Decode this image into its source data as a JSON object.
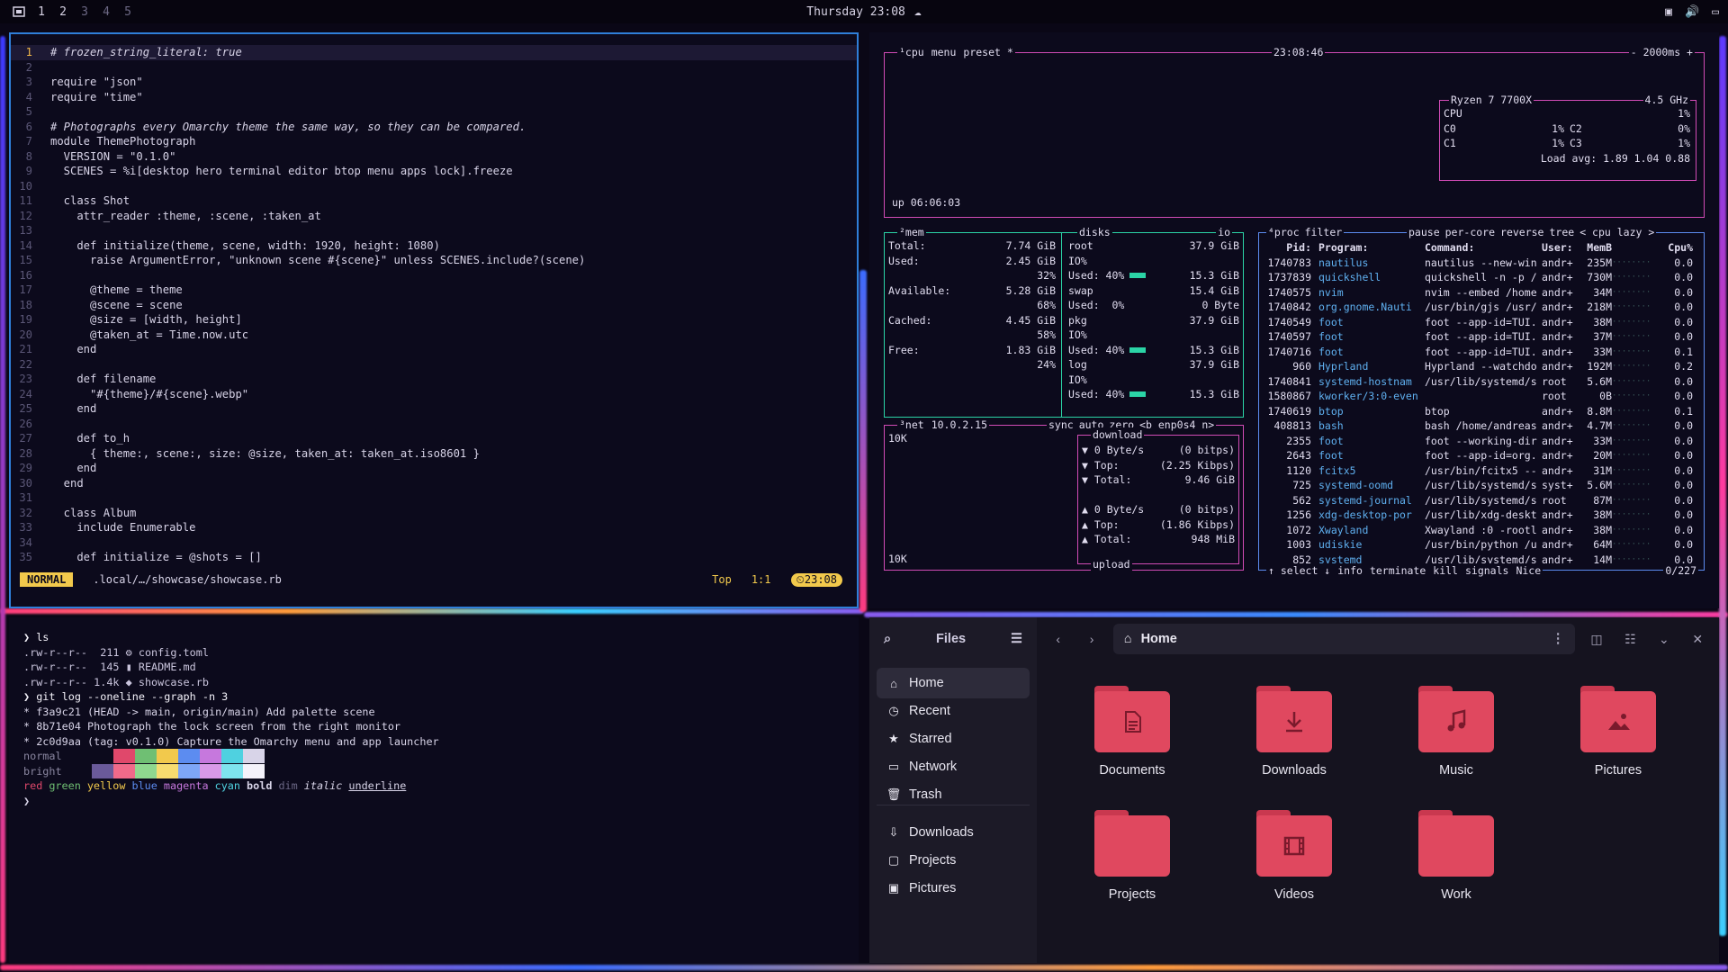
{
  "topbar": {
    "workspaces": [
      "1",
      "2",
      "3",
      "4",
      "5"
    ],
    "clock": "Thursday 23:08"
  },
  "editor": {
    "lines": [
      {
        "n": "1",
        "t": "# frozen_string_literal: true"
      },
      {
        "n": "2",
        "t": ""
      },
      {
        "n": "3",
        "t": "require \"json\""
      },
      {
        "n": "4",
        "t": "require \"time\""
      },
      {
        "n": "5",
        "t": ""
      },
      {
        "n": "6",
        "t": "# Photographs every Omarchy theme the same way, so they can be compared."
      },
      {
        "n": "7",
        "t": "module ThemePhotograph"
      },
      {
        "n": "8",
        "t": "  VERSION = \"0.1.0\""
      },
      {
        "n": "9",
        "t": "  SCENES = %i[desktop hero terminal editor btop menu apps lock].freeze"
      },
      {
        "n": "10",
        "t": ""
      },
      {
        "n": "11",
        "t": "  class Shot"
      },
      {
        "n": "12",
        "t": "    attr_reader :theme, :scene, :taken_at"
      },
      {
        "n": "13",
        "t": ""
      },
      {
        "n": "14",
        "t": "    def initialize(theme, scene, width: 1920, height: 1080)"
      },
      {
        "n": "15",
        "t": "      raise ArgumentError, \"unknown scene #{scene}\" unless SCENES.include?(scene)"
      },
      {
        "n": "16",
        "t": ""
      },
      {
        "n": "17",
        "t": "      @theme = theme"
      },
      {
        "n": "18",
        "t": "      @scene = scene"
      },
      {
        "n": "19",
        "t": "      @size = [width, height]"
      },
      {
        "n": "20",
        "t": "      @taken_at = Time.now.utc"
      },
      {
        "n": "21",
        "t": "    end"
      },
      {
        "n": "22",
        "t": ""
      },
      {
        "n": "23",
        "t": "    def filename"
      },
      {
        "n": "24",
        "t": "      \"#{theme}/#{scene}.webp\""
      },
      {
        "n": "25",
        "t": "    end"
      },
      {
        "n": "26",
        "t": ""
      },
      {
        "n": "27",
        "t": "    def to_h"
      },
      {
        "n": "28",
        "t": "      { theme:, scene:, size: @size, taken_at: taken_at.iso8601 }"
      },
      {
        "n": "29",
        "t": "    end"
      },
      {
        "n": "30",
        "t": "  end"
      },
      {
        "n": "31",
        "t": ""
      },
      {
        "n": "32",
        "t": "  class Album"
      },
      {
        "n": "33",
        "t": "    include Enumerable"
      },
      {
        "n": "34",
        "t": ""
      },
      {
        "n": "35",
        "t": "    def initialize = @shots = []"
      }
    ],
    "mode": "NORMAL",
    "file": ".local/…/showcase/showcase.rb",
    "position_word": "Top",
    "cursor": "1:1",
    "time": "23:08"
  },
  "btop": {
    "cpu_header": [
      "¹cpu",
      "menu",
      "preset *"
    ],
    "clock": "23:08:46",
    "interval": "- 2000ms +",
    "uptime": "up 06:06:03",
    "cpu_model": "Ryzen 7 7700X",
    "cpu_freq": "4.5 GHz",
    "cpu_rows": [
      {
        "l": "CPU",
        "v": "1%"
      },
      {
        "l": "C0",
        "v": "1%",
        "l2": "C2",
        "v2": "0%"
      },
      {
        "l": "C1",
        "v": "1%",
        "l2": "C3",
        "v2": "1%"
      }
    ],
    "load_avg": "Load avg: 1.89 1.04 0.88",
    "mem_header": "²mem",
    "disks_header": "disks",
    "io_label": "io",
    "mem_rows": [
      {
        "k": "Total:",
        "v": "7.74 GiB"
      },
      {
        "k": "Used:",
        "v": "2.45 GiB",
        "p": "32%"
      },
      {
        "k": "Available:",
        "v": "5.28 GiB",
        "p": "68%"
      },
      {
        "k": "Cached:",
        "v": "4.45 GiB",
        "p": "58%"
      },
      {
        "k": "Free:",
        "v": "1.83 GiB",
        "p": "24%"
      }
    ],
    "disk_rows": [
      {
        "k": "root",
        "v": "37.9 GiB"
      },
      {
        "k": "IO%",
        "v": ""
      },
      {
        "k": "Used: 40%",
        "v": "15.3 GiB",
        "fill": 0.4
      },
      {
        "k": "swap",
        "v": "15.4 GiB"
      },
      {
        "k": "Used:  0%",
        "v": "0 Byte"
      },
      {
        "k": "pkg",
        "v": "37.9 GiB"
      },
      {
        "k": "IO%",
        "v": ""
      },
      {
        "k": "Used: 40%",
        "v": "15.3 GiB",
        "fill": 0.4
      },
      {
        "k": "log",
        "v": "37.9 GiB"
      },
      {
        "k": "IO%",
        "v": ""
      },
      {
        "k": "Used: 40%",
        "v": "15.3 GiB",
        "fill": 0.4
      }
    ],
    "net_header": [
      "³net",
      "10.0.2.15",
      "sync",
      "auto",
      "zero",
      "<b enp0s4 n>"
    ],
    "net_scale_top": "10K",
    "net_scale_bottom": "10K",
    "download_label": "download",
    "upload_label": "upload",
    "down_rows": [
      {
        "k": "▼ 0 Byte/s",
        "v": "(0 bitps)"
      },
      {
        "k": "▼ Top:",
        "v": "(2.25 Kibps)"
      },
      {
        "k": "▼ Total:",
        "v": "9.46 GiB"
      }
    ],
    "up_rows": [
      {
        "k": "▲ 0 Byte/s",
        "v": "(0 bitps)"
      },
      {
        "k": "▲ Top:",
        "v": "(1.86 Kibps)"
      },
      {
        "k": "▲ Total:",
        "v": "948 MiB"
      }
    ],
    "proc_header": [
      "⁴proc",
      "filter",
      "pause",
      "per-core",
      "reverse",
      "tree",
      "< cpu lazy >"
    ],
    "proc_cols": [
      "Pid:",
      "Program:",
      "Command:",
      "User:",
      "MemB",
      "",
      "Cpu%"
    ],
    "procs": [
      [
        "1740783",
        "nautilus",
        "nautilus --new-win",
        "andr+",
        "235M",
        "0.0"
      ],
      [
        "1737839",
        "quickshell",
        "quickshell -n -p /",
        "andr+",
        "730M",
        "0.0"
      ],
      [
        "1740575",
        "nvim",
        "nvim --embed /home",
        "andr+",
        "34M",
        "0.0"
      ],
      [
        "1740842",
        "org.gnome.Nauti",
        "/usr/bin/gjs /usr/",
        "andr+",
        "218M",
        "0.0"
      ],
      [
        "1740549",
        "foot",
        "foot --app-id=TUI.",
        "andr+",
        "38M",
        "0.0"
      ],
      [
        "1740597",
        "foot",
        "foot --app-id=TUI.",
        "andr+",
        "37M",
        "0.0"
      ],
      [
        "1740716",
        "foot",
        "foot --app-id=TUI.",
        "andr+",
        "33M",
        "0.1"
      ],
      [
        "960",
        "Hyprland",
        "Hyprland --watchdo",
        "andr+",
        "192M",
        "0.2"
      ],
      [
        "1740841",
        "systemd-hostnam",
        "/usr/lib/systemd/s",
        "root",
        "5.6M",
        "0.0"
      ],
      [
        "1580867",
        "kworker/3:0-even",
        "",
        "root",
        "0B",
        "0.0"
      ],
      [
        "1740619",
        "btop",
        "btop",
        "andr+",
        "8.8M",
        "0.1"
      ],
      [
        "408813",
        "bash",
        "bash /home/andreas",
        "andr+",
        "4.7M",
        "0.0"
      ],
      [
        "2355",
        "foot",
        "foot --working-dir",
        "andr+",
        "33M",
        "0.0"
      ],
      [
        "2643",
        "foot",
        "foot --app-id=org.",
        "andr+",
        "20M",
        "0.0"
      ],
      [
        "1120",
        "fcitx5",
        "/usr/bin/fcitx5 --",
        "andr+",
        "31M",
        "0.0"
      ],
      [
        "725",
        "systemd-oomd",
        "/usr/lib/systemd/s",
        "syst+",
        "5.6M",
        "0.0"
      ],
      [
        "562",
        "systemd-journal",
        "/usr/lib/systemd/s",
        "root",
        "87M",
        "0.0"
      ],
      [
        "1256",
        "xdg-desktop-por",
        "/usr/lib/xdg-deskt",
        "andr+",
        "38M",
        "0.0"
      ],
      [
        "1072",
        "Xwayland",
        "Xwayland :0 -rootl",
        "andr+",
        "38M",
        "0.0"
      ],
      [
        "1003",
        "udiskie",
        "/usr/bin/python /u",
        "andr+",
        "64M",
        "0.0"
      ],
      [
        "852",
        "systemd",
        "/usr/lib/systemd/s",
        "andr+",
        "14M",
        "0.0"
      ]
    ],
    "proc_footer": [
      "↑ select ↓",
      "info",
      "terminate",
      "kill",
      "signals",
      "Nice"
    ],
    "proc_count": "0/227"
  },
  "terminal": {
    "lines": [
      "❯ ls",
      ".rw-r--r--  211 ⚙ config.toml",
      ".rw-r--r--  145 ▮ README.md",
      ".rw-r--r-- 1.4k ◆ showcase.rb",
      "❯ git log --oneline --graph -n 3",
      "* f3a9c21 (HEAD -> main, origin/main) Add palette scene",
      "* 8b71e04 Photograph the lock screen from the right monitor",
      "* 2c0d9aa (tag: v0.1.0) Capture the Omarchy menu and app launcher"
    ],
    "normal_label": "normal",
    "bright_label": "bright",
    "normal_colors": [
      "#0c0a1c",
      "#e0486b",
      "#6fbf73",
      "#f2c94c",
      "#5c8cf0",
      "#c678dd",
      "#4fd1e0",
      "#d8d4e8"
    ],
    "bright_colors": [
      "#6a5a9a",
      "#f06a8a",
      "#8fd88f",
      "#f7dc6f",
      "#7ea6f7",
      "#d99ae8",
      "#7ee3ee",
      "#f4f2fa"
    ],
    "style_words": [
      "red",
      "green",
      "yellow",
      "blue",
      "magenta",
      "cyan",
      "bold",
      "dim",
      "italic",
      "underline"
    ],
    "prompt": "❯"
  },
  "files": {
    "app_title": "Files",
    "path": "Home",
    "sidebar": [
      {
        "label": "Home",
        "icon": "home-icon"
      },
      {
        "label": "Recent",
        "icon": "clock-icon"
      },
      {
        "label": "Starred",
        "icon": "star-icon"
      },
      {
        "label": "Network",
        "icon": "network-icon"
      },
      {
        "label": "Trash",
        "icon": "trash-icon"
      },
      {
        "label": "Downloads",
        "icon": "download-icon"
      },
      {
        "label": "Projects",
        "icon": "folder-icon"
      },
      {
        "label": "Pictures",
        "icon": "image-icon"
      }
    ],
    "folders": [
      {
        "label": "Documents",
        "icon": "document-icon"
      },
      {
        "label": "Downloads",
        "icon": "download-icon"
      },
      {
        "label": "Music",
        "icon": "music-icon"
      },
      {
        "label": "Pictures",
        "icon": "image-icon"
      },
      {
        "label": "Projects",
        "icon": ""
      },
      {
        "label": "Videos",
        "icon": "video-icon"
      },
      {
        "label": "Work",
        "icon": ""
      }
    ],
    "accent": "#e0485f"
  }
}
